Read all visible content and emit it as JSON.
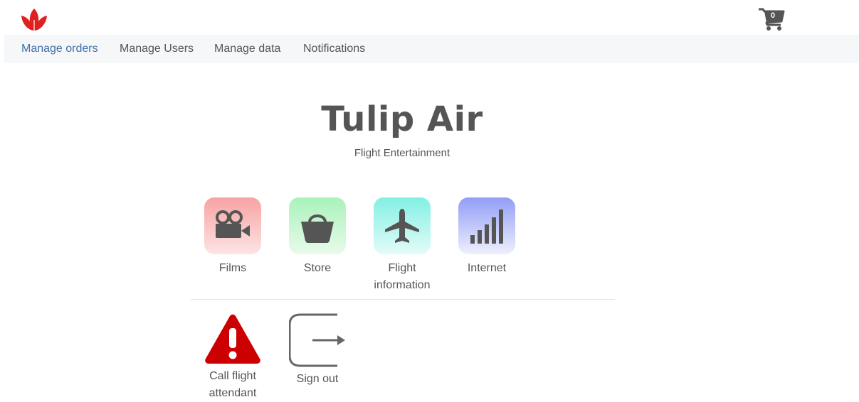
{
  "header": {
    "logo_icon": "tulip-logo-icon",
    "cart_icon": "shopping-cart-icon",
    "cart_count": "0"
  },
  "nav": {
    "items": [
      {
        "label": "Manage orders",
        "active": true
      },
      {
        "label": "Manage Users",
        "active": false
      },
      {
        "label": "Manage data",
        "active": false
      },
      {
        "label": "Notifications",
        "active": false
      }
    ]
  },
  "main": {
    "title": "Tulip Air",
    "subtitle": "Flight Entertainment",
    "tiles": [
      {
        "label": "Films",
        "icon": "film-camera-icon",
        "color": "#f7a8a8"
      },
      {
        "label": "Store",
        "icon": "shopping-basket-icon",
        "color": "#aef3bf"
      },
      {
        "label": "Flight information",
        "icon": "airplane-icon",
        "color": "#8cf2e6"
      },
      {
        "label": "Internet",
        "icon": "signal-bars-icon",
        "color": "#9aa4f7"
      }
    ],
    "actions": [
      {
        "label": "Call flight attendant",
        "icon": "warning-icon",
        "color": "#cc0000"
      },
      {
        "label": "Sign out",
        "icon": "sign-out-icon",
        "color": "#666666"
      }
    ]
  },
  "colors": {
    "accent": "#3f6fa8",
    "logo": "#e01f1f",
    "icon_gray": "#555555",
    "nav_bg": "#f6f7f9"
  }
}
